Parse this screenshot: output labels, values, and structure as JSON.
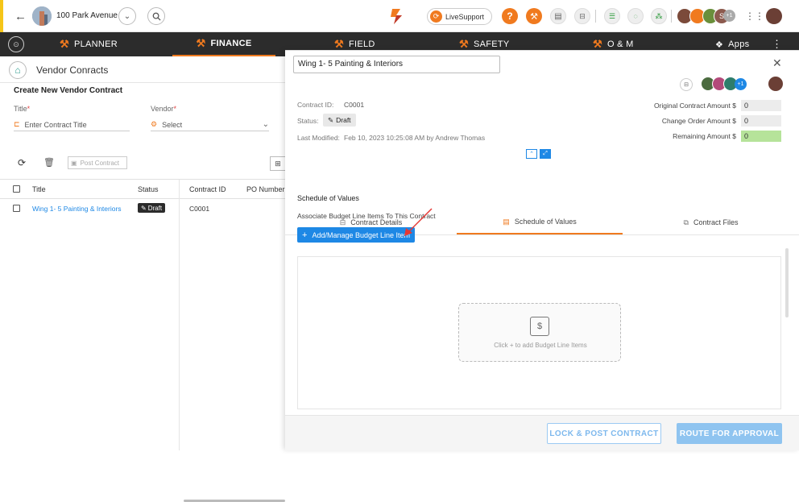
{
  "header": {
    "project_name": "100 Park Avenue",
    "livesupport_label": "LiveSupport",
    "avatar_extra": "S",
    "avatar_more": "+1"
  },
  "nav": {
    "items": [
      {
        "label": "PLANNER"
      },
      {
        "label": "FINANCE"
      },
      {
        "label": "FIELD"
      },
      {
        "label": "SAFETY"
      },
      {
        "label": "O & M"
      },
      {
        "label": "Apps"
      }
    ]
  },
  "left": {
    "page_title": "Vendor Conracts",
    "create_title": "Create New Vendor Contract",
    "title_label": "Title",
    "title_placeholder": "Enter Contract Title",
    "vendor_label": "Vendor",
    "vendor_select": "Select",
    "post_contract": "Post Contract",
    "columns": [
      "Title",
      "Status",
      "Contract ID",
      "PO Number"
    ],
    "rows": [
      {
        "title": "Wing 1- 5 Painting & Interiors",
        "status": "Draft",
        "contract_id": "C0001",
        "po": ""
      }
    ]
  },
  "drawer": {
    "title": "Wing 1- 5 Painting & Interiors",
    "avatar_more": "+1",
    "contract_id_label": "Contract ID:",
    "contract_id": "C0001",
    "status_label": "Status:",
    "status": "Draft",
    "last_modified_label": "Last Modified:",
    "last_modified": "Feb 10, 2023 10:25:08 AM by Andrew Thomas",
    "original_label": "Original Contract Amount $",
    "original_value": "0",
    "change_label": "Change Order Amount $",
    "change_value": "0",
    "remaining_label": "Remaining Amount $",
    "remaining_value": "0",
    "tabs": [
      {
        "label": "Contract Details"
      },
      {
        "label": "Schedule of Values"
      },
      {
        "label": "Contract Files"
      }
    ],
    "sov_heading": "Schedule of Values",
    "associate_text": "Associate Budget Line Items To This Contract",
    "add_button": "Add/Manage Budget Line Item",
    "empty_text": "Click + to add Budget Line Items",
    "lock_post": "LOCK & POST CONTRACT",
    "route": "ROUTE FOR APPROVAL"
  },
  "colors": {
    "accent_orange": "#f07a1f",
    "primary_blue": "#1e88e5",
    "nav_dark": "#2c2c2c",
    "link_blue": "#1e88e5",
    "remaining_green": "#b6e39a"
  }
}
